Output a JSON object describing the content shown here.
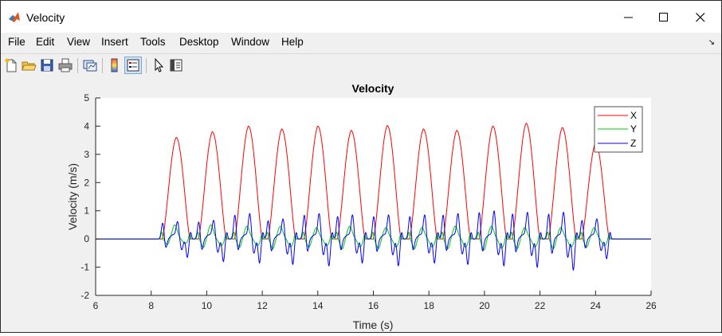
{
  "window": {
    "title": "Velocity"
  },
  "menu": [
    "File",
    "Edit",
    "View",
    "Insert",
    "Tools",
    "Desktop",
    "Window",
    "Help"
  ],
  "toolbar": {
    "icons": [
      "new-figure-icon",
      "open-file-icon",
      "save-icon",
      "print-icon",
      "link-plot-icon",
      "colorbar-icon",
      "legend-icon",
      "edit-plot-arrow-icon",
      "property-inspector-icon"
    ]
  },
  "colors": {
    "x": "#ff0000",
    "y": "#00cc00",
    "z": "#0000ff",
    "axes_bg": "#ffffff",
    "figure_bg": "#f0f0f0"
  },
  "chart_data": {
    "type": "line",
    "title": "Velocity",
    "xlabel": "Time (s)",
    "ylabel": "Velocity (m/s)",
    "xlim": [
      6,
      26
    ],
    "ylim": [
      -2,
      5
    ],
    "xticks": [
      6,
      8,
      10,
      12,
      14,
      16,
      18,
      20,
      22,
      24,
      26
    ],
    "yticks": [
      -2,
      -1,
      0,
      1,
      2,
      3,
      4,
      5
    ],
    "legend_position": "top-right",
    "grid": false,
    "stride_centers": [
      8.9,
      10.2,
      11.5,
      12.7,
      14.0,
      15.2,
      16.5,
      17.8,
      19.0,
      20.3,
      21.5,
      22.8,
      24.0
    ],
    "x_peaks": [
      3.6,
      3.8,
      4.0,
      3.9,
      4.0,
      3.85,
      4.02,
      3.9,
      3.85,
      4.0,
      4.1,
      3.95,
      3.4
    ],
    "y_peaks": [
      0.5,
      0.5,
      0.45,
      0.45,
      0.4,
      0.45,
      0.4,
      0.4,
      0.45,
      0.45,
      0.4,
      0.4,
      0.4
    ],
    "y_troughs": [
      -0.2,
      -0.3,
      -0.3,
      -0.35,
      -0.3,
      -0.35,
      -0.35,
      -0.35,
      -0.35,
      -0.4,
      -0.35,
      -0.35,
      -0.3
    ],
    "z_peaks": [
      0.6,
      0.65,
      0.9,
      0.7,
      0.9,
      0.85,
      0.85,
      0.85,
      0.9,
      1.0,
      0.95,
      0.95,
      0.7
    ],
    "z_troughs": [
      -0.65,
      -0.8,
      -0.85,
      -0.9,
      -0.95,
      -0.85,
      -0.95,
      -0.85,
      -0.9,
      -0.95,
      -1.0,
      -1.1,
      -0.7
    ],
    "series": [
      {
        "name": "X",
        "color": "#ff0000"
      },
      {
        "name": "Y",
        "color": "#00cc00"
      },
      {
        "name": "Z",
        "color": "#0000ff"
      }
    ]
  }
}
